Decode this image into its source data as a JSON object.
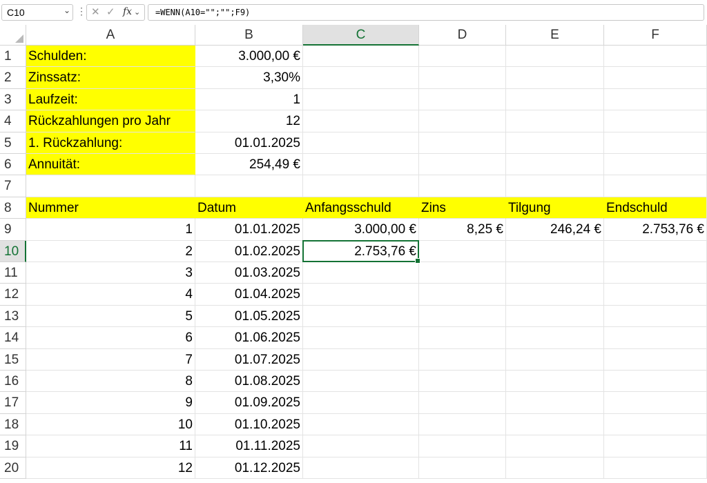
{
  "formula_bar": {
    "name_box": "C10",
    "formula": "=WENN(A10=\"\";\"\";F9)",
    "fx_label": "fx"
  },
  "columns": [
    "A",
    "B",
    "C",
    "D",
    "E",
    "F"
  ],
  "rows": [
    "1",
    "2",
    "3",
    "4",
    "5",
    "6",
    "7",
    "8",
    "9",
    "10",
    "11",
    "12",
    "13",
    "14",
    "15",
    "16",
    "17",
    "18",
    "19",
    "20"
  ],
  "params": [
    {
      "label": "Schulden:",
      "value": "3.000,00 €"
    },
    {
      "label": "Zinssatz:",
      "value": "3,30%"
    },
    {
      "label": "Laufzeit:",
      "value": "1"
    },
    {
      "label": "Rückzahlungen pro Jahr",
      "value": "12"
    },
    {
      "label": "1. Rückzahlung:",
      "value": "01.01.2025"
    },
    {
      "label": "Annuität:",
      "value": "254,49 €"
    }
  ],
  "table_headers": [
    "Nummer",
    "Datum",
    "Anfangsschuld",
    "Zins",
    "Tilgung",
    "Endschuld"
  ],
  "table_rows": [
    {
      "nr": "1",
      "datum": "01.01.2025",
      "anfang": "3.000,00 €",
      "zins": "8,25 €",
      "tilgung": "246,24 €",
      "end": "2.753,76 €"
    },
    {
      "nr": "2",
      "datum": "01.02.2025",
      "anfang": "2.753,76 €",
      "zins": "",
      "tilgung": "",
      "end": ""
    },
    {
      "nr": "3",
      "datum": "01.03.2025",
      "anfang": "",
      "zins": "",
      "tilgung": "",
      "end": ""
    },
    {
      "nr": "4",
      "datum": "01.04.2025",
      "anfang": "",
      "zins": "",
      "tilgung": "",
      "end": ""
    },
    {
      "nr": "5",
      "datum": "01.05.2025",
      "anfang": "",
      "zins": "",
      "tilgung": "",
      "end": ""
    },
    {
      "nr": "6",
      "datum": "01.06.2025",
      "anfang": "",
      "zins": "",
      "tilgung": "",
      "end": ""
    },
    {
      "nr": "7",
      "datum": "01.07.2025",
      "anfang": "",
      "zins": "",
      "tilgung": "",
      "end": ""
    },
    {
      "nr": "8",
      "datum": "01.08.2025",
      "anfang": "",
      "zins": "",
      "tilgung": "",
      "end": ""
    },
    {
      "nr": "9",
      "datum": "01.09.2025",
      "anfang": "",
      "zins": "",
      "tilgung": "",
      "end": ""
    },
    {
      "nr": "10",
      "datum": "01.10.2025",
      "anfang": "",
      "zins": "",
      "tilgung": "",
      "end": ""
    },
    {
      "nr": "11",
      "datum": "01.11.2025",
      "anfang": "",
      "zins": "",
      "tilgung": "",
      "end": ""
    },
    {
      "nr": "12",
      "datum": "01.12.2025",
      "anfang": "",
      "zins": "",
      "tilgung": "",
      "end": ""
    }
  ],
  "active_cell": {
    "column": "C",
    "row": "10"
  },
  "colors": {
    "highlight": "#ffff00",
    "selection": "#137234"
  }
}
